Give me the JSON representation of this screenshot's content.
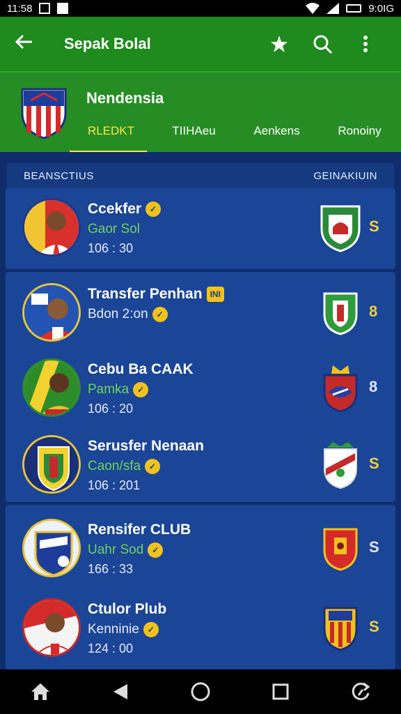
{
  "status_bar": {
    "time": "11:58",
    "battery_text": "9:0IG"
  },
  "app_bar": {
    "title": "Sepak Bolal"
  },
  "team": {
    "name": "Nendensia"
  },
  "tabs": [
    {
      "label": "RLEDKT",
      "active": true
    },
    {
      "label": "TIIHAeu",
      "active": false
    },
    {
      "label": "Aenkens",
      "active": false
    },
    {
      "label": "Ronoiny",
      "active": false
    }
  ],
  "columns": {
    "left": "BEANSCTIUS",
    "right": "GEINAKIUIN"
  },
  "matches": [
    {
      "name": "Ccekfer",
      "name_badge": "",
      "sub": "Gaor Sol",
      "time": "106 : 30",
      "score": "S"
    },
    {
      "name": "Transfer Penhan",
      "name_badge": "INI",
      "sub": "Bdon 2:on",
      "time": "",
      "score": "8"
    },
    {
      "name": "Cebu Ba CAAK",
      "name_badge": "",
      "sub": "Pamka",
      "time": "106 : 20",
      "score": "8"
    },
    {
      "name": "Serusfer Nenaan",
      "name_badge": "",
      "sub": "Caon/sfa",
      "time": "106 : 201",
      "score": "S"
    },
    {
      "name": "Rensifer CLUB",
      "name_badge": "",
      "sub": "Uahr Sod",
      "time": "166 : 33",
      "score": "S"
    },
    {
      "name": "Ctulor Plub",
      "name_badge": "",
      "sub": "Kenninie",
      "time": "124 : 00",
      "score": "S"
    }
  ],
  "colors": {
    "app_bar": "#1f8a1e",
    "card": "#1b4596",
    "accent_yellow": "#f2c21c",
    "accent_green": "#6fd35b"
  }
}
